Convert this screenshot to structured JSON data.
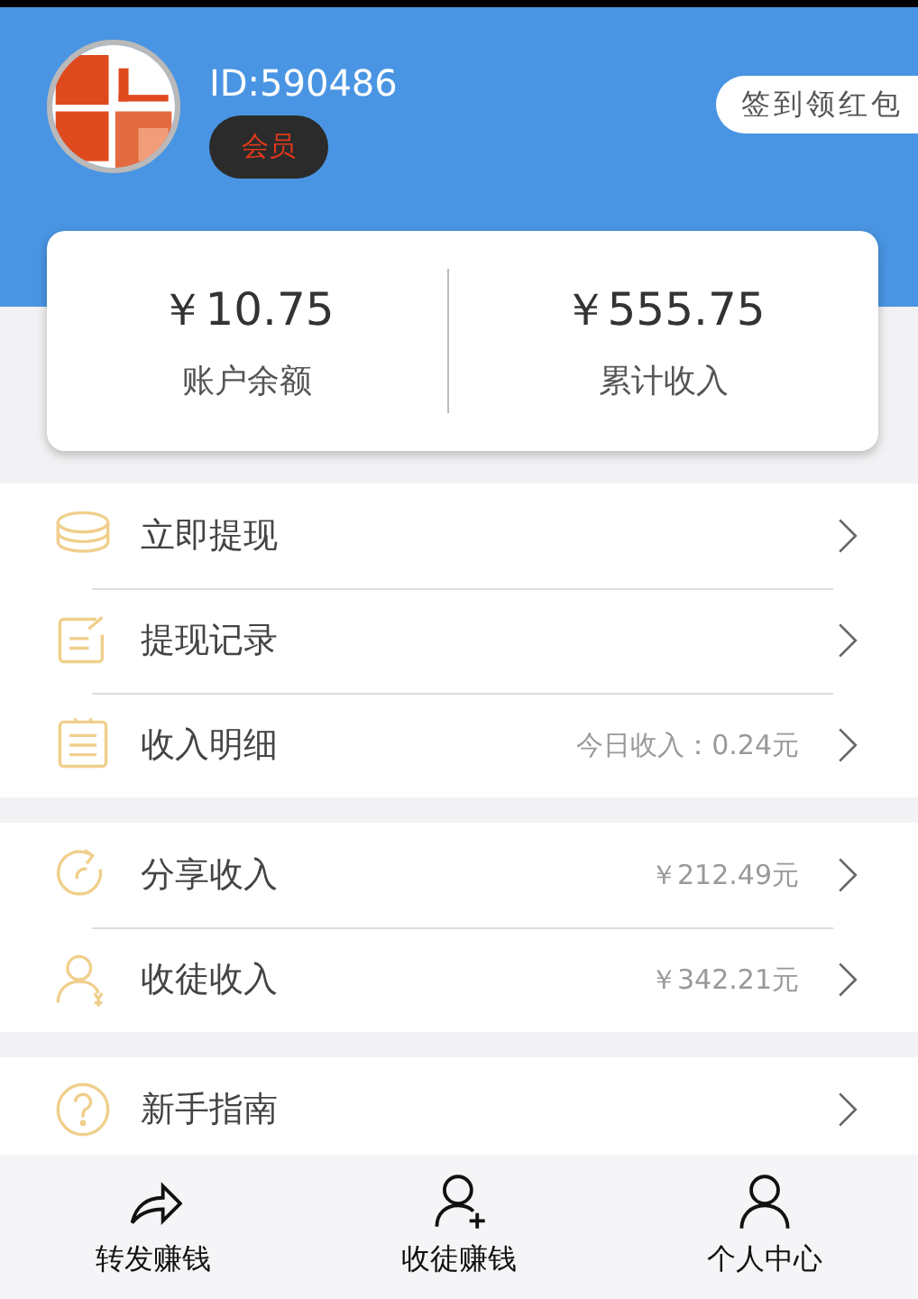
{
  "profile": {
    "id_text": "ID:590486",
    "badge": "会员",
    "checkin_button": "签到领红包"
  },
  "summary": [
    {
      "amount": "￥10.75",
      "label": "账户余额"
    },
    {
      "amount": "￥555.75",
      "label": "累计收入"
    }
  ],
  "sections": [
    {
      "items": [
        {
          "kind": "coins",
          "label": "立即提现"
        },
        {
          "kind": "note",
          "label": "提现记录"
        },
        {
          "kind": "list",
          "label": "收入明细",
          "value": "今日收入：0.24元"
        }
      ]
    },
    {
      "items": [
        {
          "kind": "share",
          "label": "分享收入",
          "value": "￥212.49元"
        },
        {
          "kind": "user",
          "label": "收徒收入",
          "value": "￥342.21元"
        }
      ]
    },
    {
      "items": [
        {
          "kind": "help",
          "label": "新手指南"
        }
      ]
    }
  ],
  "tab_bar": [
    {
      "kind": "forward",
      "label": "转发赚钱"
    },
    {
      "kind": "add-user",
      "label": "收徒赚钱"
    },
    {
      "kind": "user",
      "label": "个人中心"
    }
  ]
}
